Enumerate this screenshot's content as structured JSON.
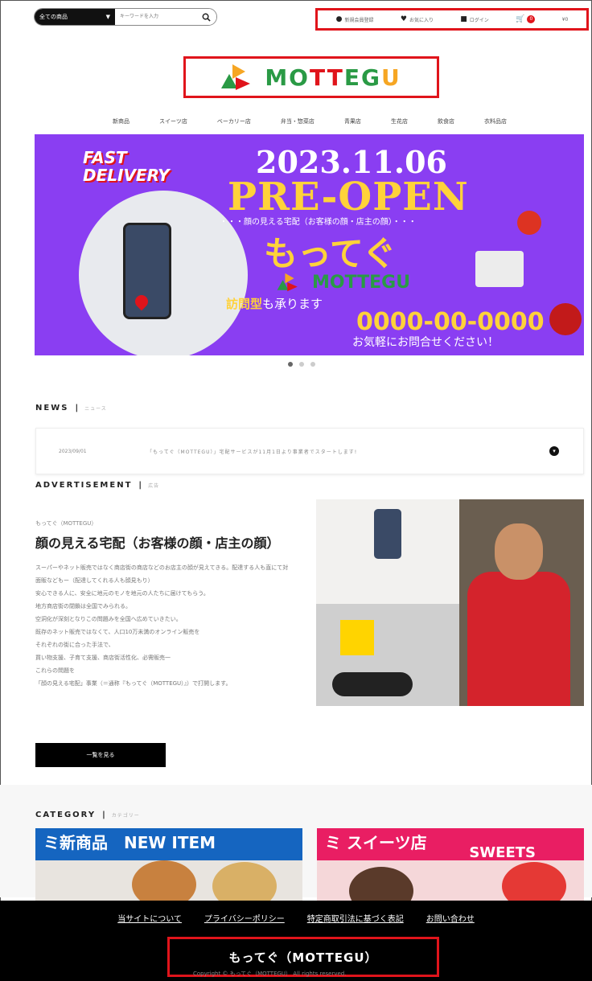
{
  "header": {
    "search": {
      "category_label": "全ての商品",
      "placeholder": "キーワードを入力"
    },
    "utility_links": [
      {
        "label": "新規会員登録",
        "icon": "user-icon"
      },
      {
        "label": "お気に入り",
        "icon": "heart-icon"
      },
      {
        "label": "ログイン",
        "icon": "lock-icon"
      }
    ],
    "cart": {
      "count": "0",
      "price": "¥0",
      "icon": "cart-icon"
    }
  },
  "logo": {
    "text_part1": "MO",
    "text_part2": "TT",
    "text_part3": "EG",
    "text_part4": "U"
  },
  "nav": {
    "items": [
      "新商品",
      "スイーツ店",
      "ベーカリー店",
      "弁当・惣菜店",
      "青果店",
      "生花店",
      "飲食店",
      "衣料品店"
    ]
  },
  "hero": {
    "fast": "FAST",
    "delivery": "DELIVERY",
    "date": "2023.11.06",
    "preopen": "PRE-OPEN",
    "subline": "・・・顔の見える宅配（お客様の顔・店主の顔）・・・",
    "brand_jp": "もってぐ",
    "brand_logo": "MOTTEGU",
    "visit_bold": "訪問型",
    "visit_rest": "も承ります",
    "phone": "0000-00-0000",
    "call": "お気軽にお問合せください！"
  },
  "news": {
    "title": "NEWS",
    "sub": "ニュース",
    "items": [
      {
        "date": "2023/09/01",
        "text": "「もってぐ（MOTTEGU）」宅配サービスが11月1日より事業者でスタートします!"
      }
    ]
  },
  "advertisement": {
    "title": "ADVERTISEMENT",
    "sub": "広告",
    "label": "もってぐ（MOTTEGU）",
    "heading": "顔の見える宅配（お客様の顔・店主の顔）",
    "body": [
      "スーパーやネット販売ではなく商店街の商店などのお店主の顔が見えてきる。配達する人も直にて対面販などもー（配達してくれる人も顔見もり）",
      "安心できる人に、安全に地元のモノを地元の人たちに届けてもらう。",
      "地方商店街の閉鎖は全国でみられる。",
      "空洞化が深刻となりこの問題みを全国へ広めていきたい。",
      "既存のネット販売ではなくて、人口10万未満のオンライン販売を",
      "それぞれの街に合った手法で、",
      "買い物支援、子育て支援、商店街活性化、必需販売一",
      "これらの問題を",
      "「顔の見える宅配」事業（＝通称『もってぐ（MOTTEGU）』）で打開します。"
    ],
    "button": "一覧を見る"
  },
  "category": {
    "title": "CATEGORY",
    "sub": "カテゴリー",
    "cards": [
      {
        "label": "ミ新商品　NEW ITEM",
        "color": "#1565c0"
      },
      {
        "label": "ミ スイーツ店",
        "label2": "SWEETS",
        "color": "#e91e63"
      }
    ]
  },
  "footer": {
    "links": [
      "当サイトについて",
      "プライバシーポリシー",
      "特定商取引法に基づく表記",
      "お問い合わせ"
    ],
    "brand": "もってぐ（MOTTEGU）",
    "copyright": "Copyright © もってぐ（MOTTEGU） All rights reserved."
  }
}
